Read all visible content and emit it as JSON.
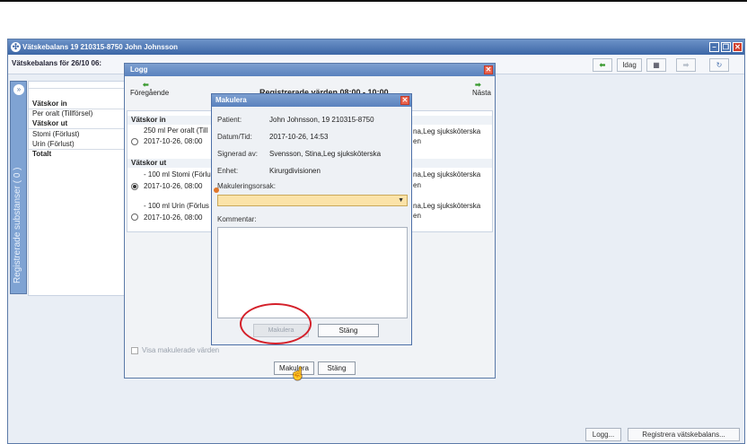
{
  "main": {
    "title": "Vätskebalans 19 210315-8750 John Johnsson",
    "subheader": "Vätskebalans för 26/10 06:",
    "toolbar": {
      "idag": "Idag"
    },
    "sidebar_label": "Registrerade substanser ( 0 )",
    "rows": [
      {
        "label": "Vätskor in",
        "header": true
      },
      {
        "label": "Per oralt (Tillförsel)"
      },
      {
        "label": "Vätskor ut",
        "header": true
      },
      {
        "label": "Stomi (Förlust)"
      },
      {
        "label": "Urin (Förlust)"
      },
      {
        "label": "Totalt",
        "header": true
      }
    ],
    "bottom_buttons": {
      "logg": "Logg...",
      "registrera": "Registrera vätskebalans..."
    }
  },
  "logg": {
    "title": "Logg",
    "prev": "Föregående",
    "next": "Nästa",
    "heading": "Registrerade värden 08:00 - 10:00",
    "sections": {
      "in": "Vätskor in",
      "out": "Vätskor ut"
    },
    "entries": [
      {
        "line1": "250 ml Per oralt (Till",
        "line2": "2017-10-26, 08:00",
        "right1": "na,Leg sjuksköterska",
        "right2": "en"
      },
      {
        "line1": "- 100 ml Stomi (Förlu",
        "line2": "2017-10-26, 08:00",
        "right1": "na,Leg sjuksköterska",
        "right2": "en"
      },
      {
        "line1": "- 100 ml Urin (Förlus",
        "line2": "2017-10-26, 08:00",
        "right1": "na,Leg sjuksköterska",
        "right2": "en"
      }
    ],
    "show_voided": "Visa makulerade värden",
    "btn_makulera": "Makulera",
    "btn_stang": "Stäng"
  },
  "makulera": {
    "title": "Makulera",
    "fields": {
      "patient_label": "Patient:",
      "patient": "John Johnsson, 19 210315-8750",
      "datum_label": "Datum/Tid:",
      "datum": "2017-10-26, 14:53",
      "signerad_label": "Signerad av:",
      "signerad": "Svensson, Stina,Leg sjuksköterska",
      "enhet_label": "Enhet:",
      "enhet": "Kirurgdivisionen"
    },
    "reason_label": "Makuleringsorsak:",
    "reason_value": "",
    "comment_label": "Kommentar:",
    "comment_value": "",
    "btn_makulera": "Makulera",
    "btn_stang": "Stäng"
  }
}
